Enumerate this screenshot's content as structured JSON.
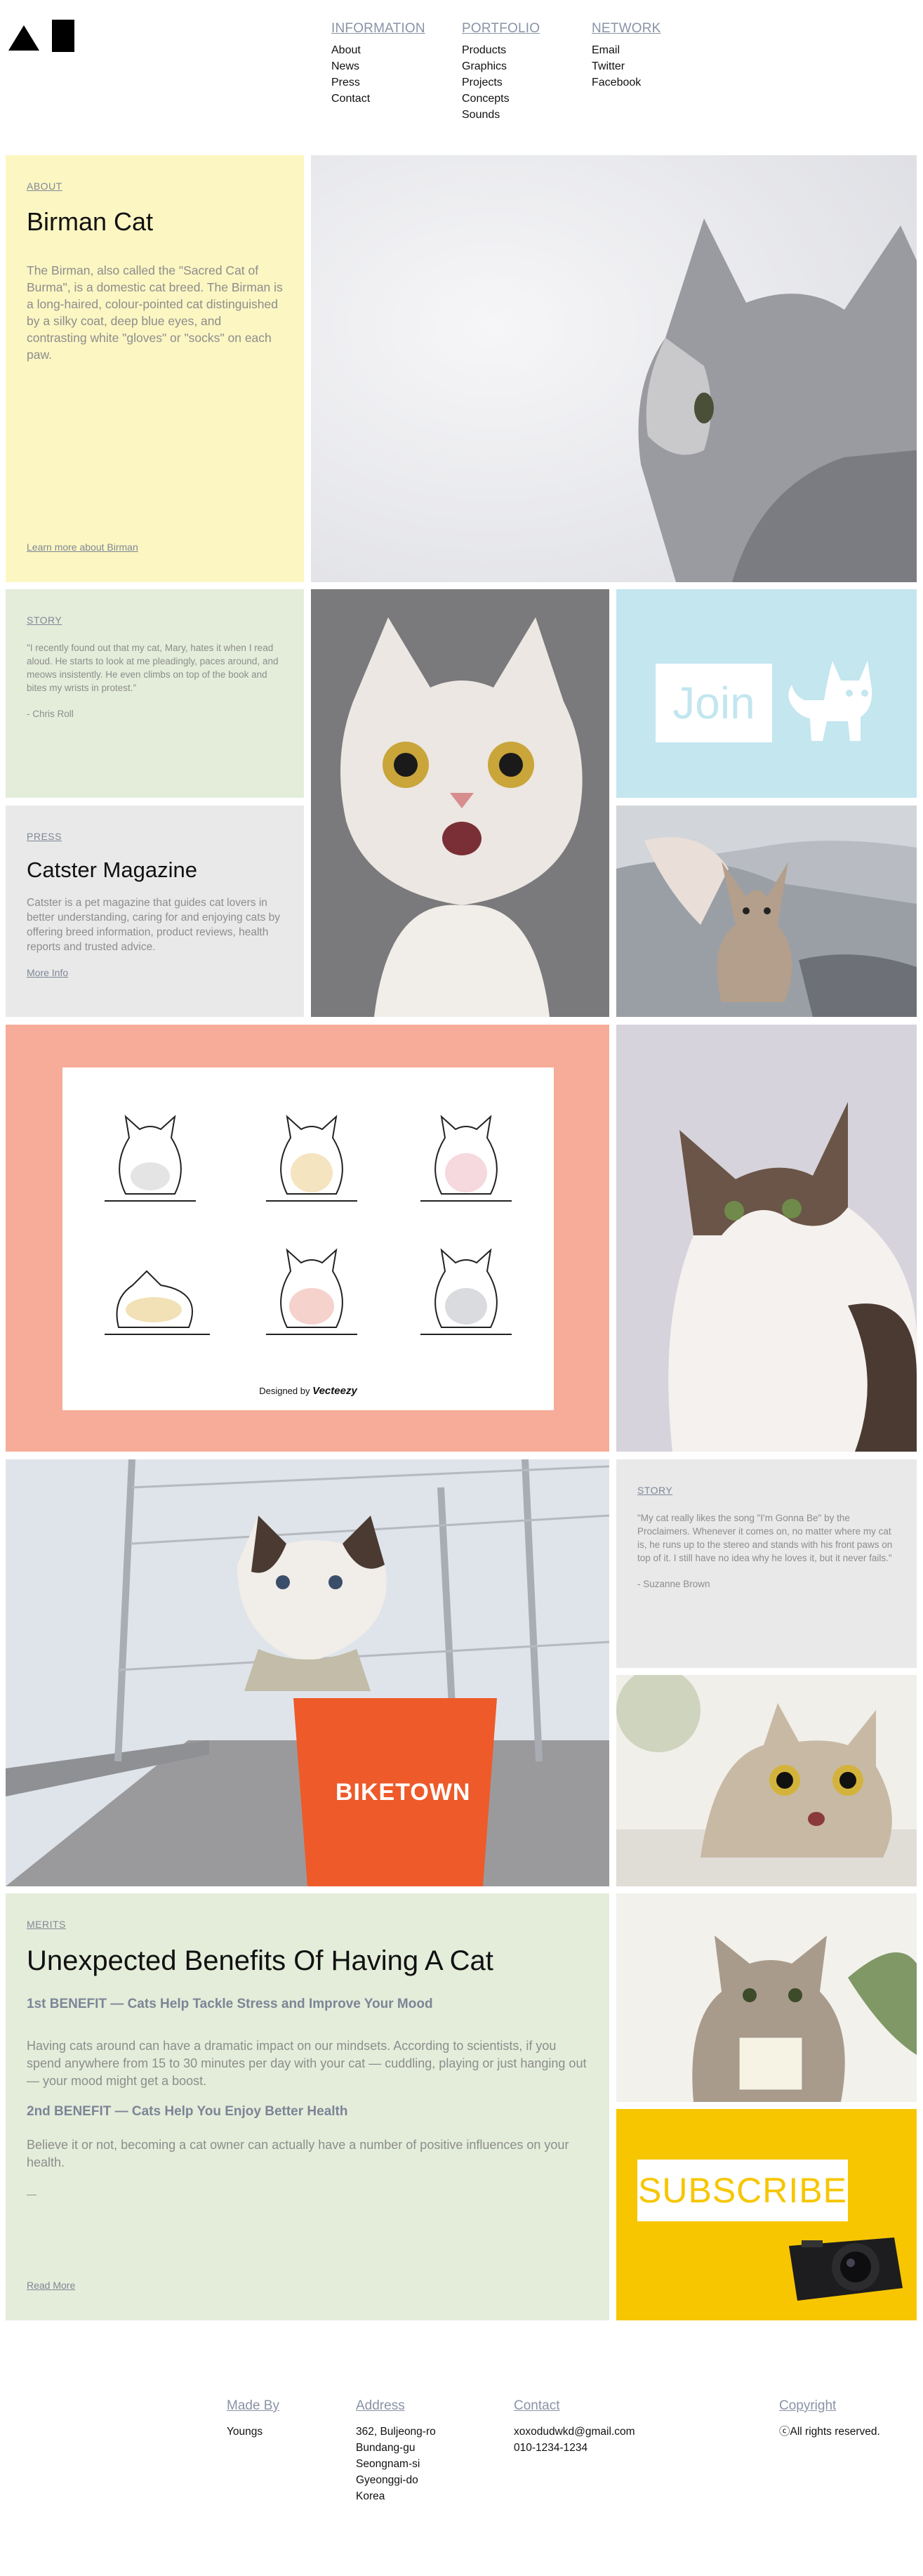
{
  "nav": {
    "columns": [
      {
        "heading": "INFORMATION",
        "links": [
          "About",
          "News",
          "Press",
          "Contact"
        ]
      },
      {
        "heading": "PORTFOLIO",
        "links": [
          "Products",
          "Graphics",
          "Projects",
          "Concepts",
          "Sounds"
        ]
      },
      {
        "heading": "NETWORK",
        "links": [
          "Email",
          "Twitter",
          "Facebook"
        ]
      }
    ]
  },
  "about": {
    "eyebrow": "ABOUT",
    "title": "Birman Cat",
    "body": "The Birman, also called the \"Sacred Cat of Burma\", is a domestic cat breed. The Birman is a long-haired, colour-pointed cat distinguished by a silky coat, deep blue eyes, and contrasting white \"gloves\" or \"socks\" on each paw.",
    "link": "Learn more about Birman"
  },
  "story1": {
    "eyebrow": "STORY",
    "quote": "\"I recently found out that my cat, Mary, hates it when I read aloud. He starts to look at me pleadingly, paces around, and meows insistently. He even climbs on top of the book and bites my wrists in protest.\"",
    "author": "- Chris Roll"
  },
  "press": {
    "eyebrow": "PRESS",
    "title": "Catster Magazine",
    "body": "Catster is a pet magazine that guides cat lovers in better understanding, caring for and enjoying cats by offering breed information, product reviews, health reports and trusted advice.",
    "link": "More Info"
  },
  "join": {
    "label": "Join"
  },
  "illustration": {
    "credit": "Designed by",
    "brand": "Vecteezy"
  },
  "story2": {
    "eyebrow": "STORY",
    "quote": "\"My cat really likes the song \"I'm Gonna Be\" by the Proclaimers. Whenever it comes on, no matter where my cat is, he runs up to the stereo and stands with his front paws on top of it. I still have no idea why he loves it, but it never fails.\"",
    "author": "- Suzanne Brown"
  },
  "biketown": {
    "sign": "BIKETOWN"
  },
  "merits": {
    "eyebrow": "MERITS",
    "title": "Unexpected Benefits Of Having A Cat",
    "benefit1_title": "1st BENEFIT — Cats Help Tackle Stress and Improve Your Mood",
    "benefit1_body": "Having cats around can have a dramatic impact on our mindsets. According to scientists, if you spend anywhere from 15 to 30 minutes per day with your cat — cuddling, playing or just hanging out — your mood might get a boost.",
    "benefit2_title": "2nd BENEFIT — Cats Help You Enjoy Better Health",
    "benefit2_body": "Believe it or not, becoming a cat owner can actually have a number of positive influences on your health.",
    "dash": "—",
    "link": "Read More"
  },
  "subscribe": {
    "label": "SUBSCRIBE"
  },
  "footer": {
    "made_by": {
      "heading": "Made By",
      "lines": [
        "Youngs"
      ]
    },
    "address": {
      "heading": "Address",
      "lines": [
        "362, Buljeong-ro",
        "Bundang-gu",
        "Seongnam-si",
        "Gyeonggi-do",
        "Korea"
      ]
    },
    "contact": {
      "heading": "Contact",
      "lines": [
        "xoxodudwkd@gmail.com",
        "010-1234-1234"
      ]
    },
    "copyright": {
      "heading": "Copyright",
      "lines": [
        "ⓒAll rights reserved."
      ]
    }
  },
  "colors": {
    "yellow": "#fcf6c2",
    "green": "#e4edda",
    "gray": "#e9e9e9",
    "sky": "#c3e6ef",
    "salmon": "#f6ac98",
    "sun": "#f7c600",
    "link": "#8a93a6"
  }
}
